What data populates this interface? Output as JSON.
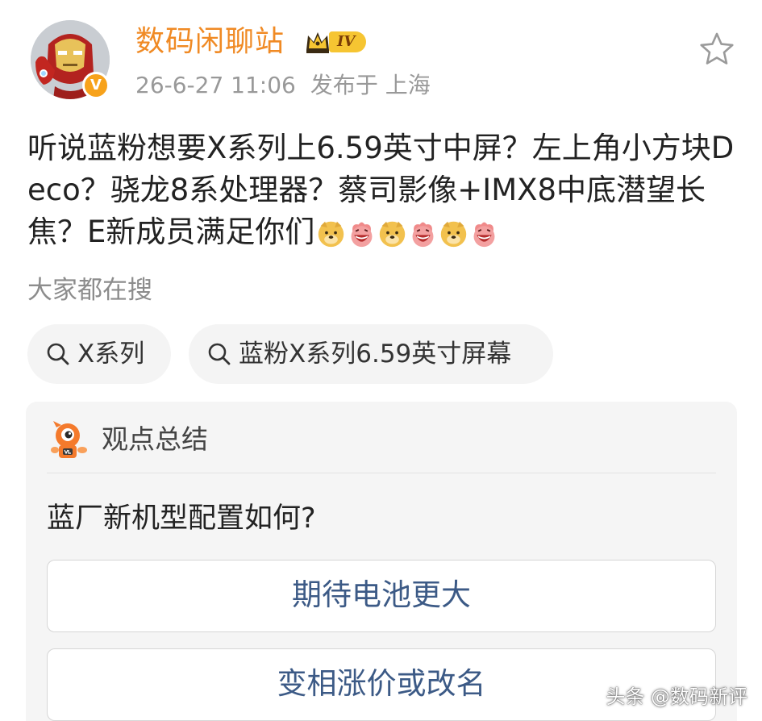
{
  "author": {
    "name": "数码闲聊站",
    "vip_level": "IV",
    "verified_mark": "V",
    "name_color": "#f08a24"
  },
  "meta": {
    "timestamp": "26-6-27 11:06",
    "location": "发布于 上海"
  },
  "post": {
    "text": "听说蓝粉想要X系列上6.59英寸中屏？左上角小方块Deco？骁龙8系处理器？蔡司影像+IMX8中底潜望长焦？E新成员满足你们",
    "emojis": [
      "doge",
      "haha",
      "doge",
      "haha",
      "doge",
      "haha"
    ]
  },
  "search": {
    "label": "大家都在搜",
    "chips": [
      {
        "label": "X系列",
        "icon": "search-icon"
      },
      {
        "label": "蓝粉X系列6.59英寸屏幕",
        "icon": "search-icon"
      }
    ]
  },
  "summary": {
    "title": "观点总结",
    "question": "蓝厂新机型配置如何?",
    "options": [
      {
        "label": "期待电池更大"
      },
      {
        "label": "变相涨价或改名"
      }
    ]
  },
  "watermark": "头条 @数码新评",
  "colors": {
    "accent": "#f08a24",
    "option_text": "#3c5a86",
    "card_bg": "#f5f5f5"
  }
}
